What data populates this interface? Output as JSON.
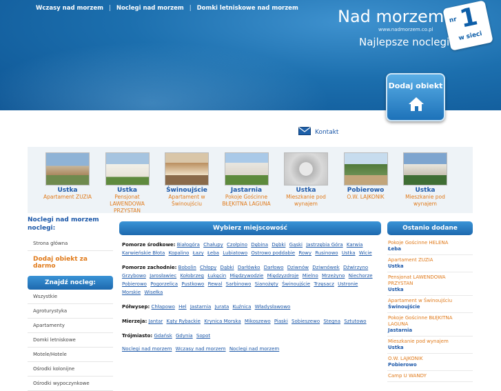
{
  "nav": {
    "items": [
      "Wczasy nad morzem",
      "Noclegi nad morzem",
      "Domki letniskowe nad morzem"
    ],
    "sep": "|"
  },
  "brand": {
    "title": "Nad morzem",
    "url": "www.nadmorzem.co.pl",
    "slogan": "Najlepsze noclegi!",
    "badge_nr": "nr",
    "badge_one": "1",
    "badge_ws": "w sieci"
  },
  "add_button": {
    "label": "Dodaj obiekt"
  },
  "contact": {
    "label": "Kontakt"
  },
  "carousel": [
    {
      "city": "Ustka",
      "name": "Apartament ZUZIA"
    },
    {
      "city": "Ustka",
      "name": "Pensjonat LAWENDOWA PRZYSTAN"
    },
    {
      "city": "Świnoujście",
      "name": "Apartament w Świnoujściu"
    },
    {
      "city": "Jastarnia",
      "name": "Pokoje Gościnne BŁĘKITNA LAGUNA"
    },
    {
      "city": "Ustka",
      "name": "Mieszkanie pod wynajem"
    },
    {
      "city": "Pobierowo",
      "name": "O.W. LAJKONIK"
    },
    {
      "city": "Ustka",
      "name": "Mieszkanie pod wynajem"
    }
  ],
  "left": {
    "title": "Noclegi nad morzem noclegi:",
    "home": "Strona główna",
    "add": "Dodaj obiekt za darmo",
    "find_title": "Znajdź nocleg:",
    "categories": [
      "Wszystkie",
      "Agroturystyka",
      "Apartamenty",
      "Domki letniskowe",
      "Motele/Hotele",
      "Ośrodki kolonijne",
      "Ośrodki wypoczynkowe"
    ]
  },
  "main": {
    "title": "Wybierz miejscowość",
    "regions": [
      {
        "label": "Pomorze środkowe:",
        "towns": [
          "Białogóra",
          "Chałupy",
          "Czołpino",
          "Dębina",
          "Dębki",
          "Gąski",
          "Jastrzębia Góra",
          "Karwia",
          "Karwieńskie Błota",
          "Kopalino",
          "Łazy",
          "Łeba",
          "Lubiatowo",
          "Ostrowo poddabie",
          "Rowy",
          "Rusinowo",
          "Ustka",
          "Wicie"
        ]
      },
      {
        "label": "Pomorze zachodnie:",
        "towns": [
          "Bobolin",
          "Chłopy",
          "Dąbki",
          "Darłówko",
          "Darłowo",
          "Dziwnów",
          "Dziwnówek",
          "Dźwirzyno",
          "Grzybowo",
          "Jarosławiec",
          "Kołobrzeg",
          "Łukęcin",
          "Międzywodzie",
          "Międzyzdroje",
          "Mielno",
          "Mrzeżyno",
          "Niechorze",
          "Pobierowo",
          "Pogorzelica",
          "Pustkowo",
          "Rewal",
          "Sarbinowo",
          "Sianożęty",
          "Świnoujście",
          "Trzęsacz",
          "Ustronie Morskie",
          "Wisełka"
        ]
      },
      {
        "label": "Półwysep:",
        "towns": [
          "Chłapowo",
          "Hel",
          "Jastarnia",
          "Jurata",
          "Kuźnica",
          "Władysławowo"
        ]
      },
      {
        "label": "Mierzeja:",
        "towns": [
          "Jantar",
          "Kąty Rybackie",
          "Krynica Morska",
          "Mikoszewo",
          "Piaski",
          "Sobieszewo",
          "Stegna",
          "Sztutowo"
        ]
      },
      {
        "label": "Trójmiasto:",
        "towns": [
          "Gdańsk",
          "Gdynia",
          "Sopot"
        ]
      }
    ],
    "footer_links": [
      "Noclegi nad morzem",
      "Wczasy nad morzem",
      "Noclegi nad morzem"
    ]
  },
  "right": {
    "title": "Ostanio dodane",
    "entries": [
      {
        "name": "Pokoje Gościnne HELENA",
        "city": "Łeba"
      },
      {
        "name": "Apartament ZUZIA",
        "city": "Ustka"
      },
      {
        "name": "Pensjonat LAWENDOWA PRZYSTAN",
        "city": "Ustka"
      },
      {
        "name": "Apartament w Świnoujściu",
        "city": "Świnoujście"
      },
      {
        "name": "Pokoje Gościnne BŁĘKITNA LAGUNA",
        "city": "Jastarnia"
      },
      {
        "name": "Mieszkanie pod wynajem",
        "city": "Ustka"
      },
      {
        "name": "O.W. LAJKONIK",
        "city": "Pobierowo"
      },
      {
        "name": "Camp U WANDY",
        "city": ""
      }
    ]
  },
  "colors": {
    "primary": "#1b57a8",
    "accent": "#e07a1a",
    "header_blue": "#1c6fae"
  }
}
